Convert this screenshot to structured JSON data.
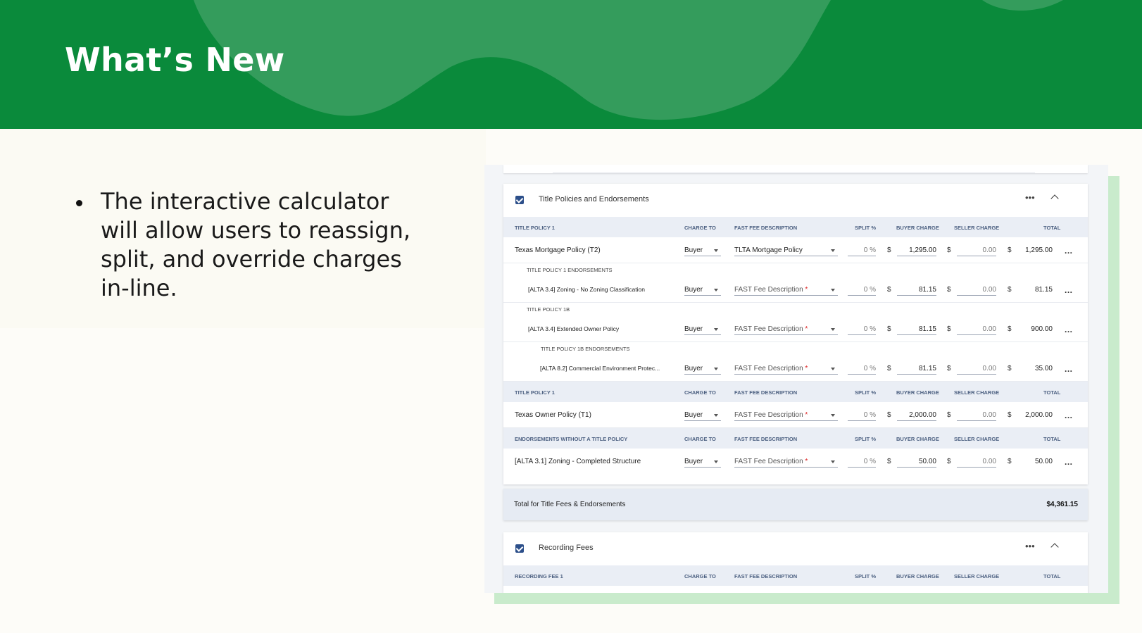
{
  "slide": {
    "title": "What’s New",
    "bullet": "The interactive calculator will allow users to reassign, split, and override charges in-line.",
    "colors": {
      "banner": "#0a8a3b",
      "banner_blob": "#349c5c",
      "accent_shadow": "#c9ebcc"
    }
  },
  "calculator": {
    "title_section": {
      "title": "Title Policies and Endorsements",
      "checked": true,
      "more_icon": "more-horizontal-icon",
      "collapse_icon": "chevron-up-icon",
      "headers": {
        "policy1": "TITLE POLICY 1",
        "policy2": "TITLE POLICY 1",
        "endorsements": "ENDORSEMENTS WITHOUT A TITLE POLICY",
        "charge_to": "CHARGE TO",
        "fee_description": "FAST FEE DESCRIPTION",
        "split": "SPLIT %",
        "buyer_charge": "BUYER CHARGE",
        "seller_charge": "SELLER CHARGE",
        "total": "TOTAL"
      },
      "subheaders": {
        "policy1_endorsements": "TITLE POLICY 1 ENDORSEMENTS",
        "policy1b": "TITLE POLICY 1B",
        "policy1b_endorsements": "TITLE POLICY 1B ENDORSEMENTS"
      },
      "currency": "$",
      "rows": [
        {
          "name": "Texas Mortgage Policy (T2)",
          "charge_to": "Buyer",
          "fee_desc": "TLTA Mortgage Policy",
          "required": "",
          "split": "0 %",
          "buyer": "1,295.00",
          "seller": "0.00",
          "total": "1,295.00"
        },
        {
          "name": "[ALTA 3.4] Zoning - No Zoning Classification",
          "charge_to": "Buyer",
          "fee_desc": "FAST Fee Description",
          "required": "*",
          "split": "0 %",
          "buyer": "81.15",
          "seller": "0.00",
          "total": "81.15"
        },
        {
          "name": "[ALTA 3.4] Extended Owner Policy",
          "charge_to": "Buyer",
          "fee_desc": "FAST Fee Description",
          "required": "*",
          "split": "0 %",
          "buyer": "81.15",
          "seller": "0.00",
          "total": "900.00"
        },
        {
          "name": "[ALTA 8.2] Commercial Environment Protec...",
          "charge_to": "Buyer",
          "fee_desc": "FAST Fee Description",
          "required": "*",
          "split": "0 %",
          "buyer": "81.15",
          "seller": "0.00",
          "total": "35.00"
        },
        {
          "name": "Texas Owner Policy (T1)",
          "charge_to": "Buyer",
          "fee_desc": "FAST Fee Description",
          "required": "*",
          "split": "0 %",
          "buyer": "2,000.00",
          "seller": "0.00",
          "total": "2,000.00"
        },
        {
          "name": "[ALTA 3.1] Zoning - Completed Structure",
          "charge_to": "Buyer",
          "fee_desc": "FAST Fee Description",
          "required": "*",
          "split": "0 %",
          "buyer": "50.00",
          "seller": "0.00",
          "total": "50.00"
        }
      ],
      "more_row": "..."
    },
    "total_bar": {
      "label": "Total for Title Fees & Endorsements",
      "amount": "$4,361.15"
    },
    "recording_section": {
      "title": "Recording Fees",
      "checked": true,
      "headers": {
        "fee1": "RECORDING FEE 1",
        "charge_to": "CHARGE TO",
        "fee_description": "FAST FEE DESCRIPTION",
        "split": "SPLIT %",
        "buyer_charge": "BUYER CHARGE",
        "seller_charge": "SELLER CHARGE",
        "total": "TOTAL"
      }
    }
  }
}
